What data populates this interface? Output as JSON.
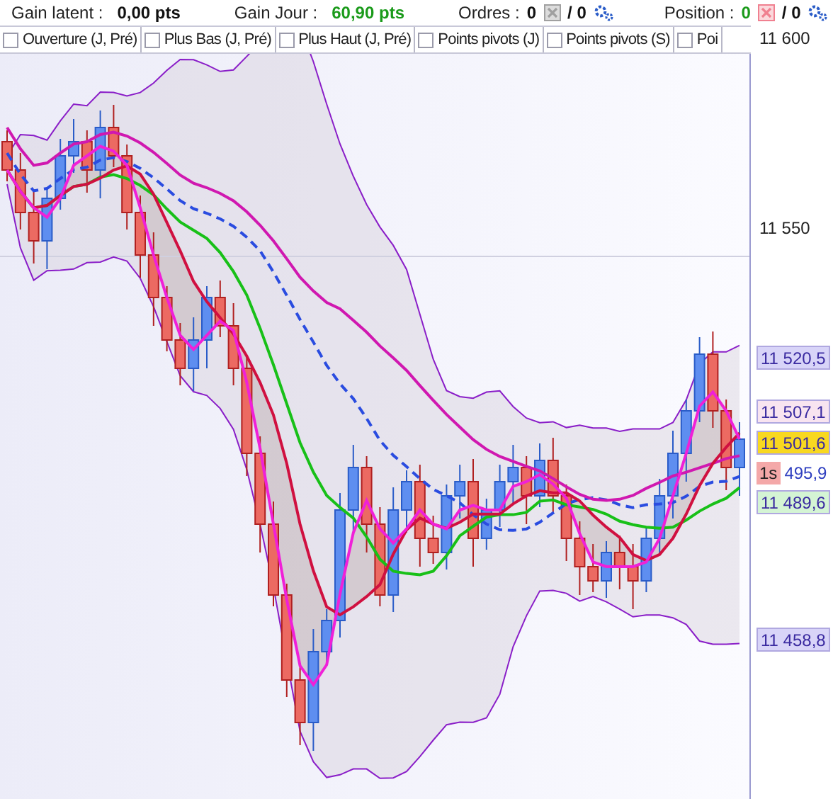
{
  "stats": [
    {
      "label": "Gain latent :",
      "value": "0,00 pts"
    },
    {
      "label": "Gain Jour :",
      "value": "60,90 pts",
      "color": "#1a9a1a"
    }
  ],
  "counters": [
    {
      "label": "Ordres :",
      "value": "0",
      "total": "/ 0",
      "kind": "orders"
    },
    {
      "label": "Position :",
      "value": "0",
      "color": "#1a9a1a",
      "total": "/ 0",
      "kind": "position"
    }
  ],
  "tabs": [
    {
      "label": "Ouverture (J, Pré)",
      "checked": false
    },
    {
      "label": "Plus Bas (J, Pré)",
      "checked": false
    },
    {
      "label": "Plus Haut (J, Pré)",
      "checked": false
    },
    {
      "label": "Points pivots (J)",
      "checked": false
    },
    {
      "label": "Points pivots (S)",
      "checked": false
    },
    {
      "label": "Poi",
      "checked": false
    }
  ],
  "axis": {
    "ticks": [
      "11 600",
      "11 550"
    ],
    "tags": [
      {
        "text": "11 520,5",
        "color": "#d8d4f8",
        "kind": "price"
      },
      {
        "text": "11 507,1",
        "color": "#f8e4f0",
        "kind": "price"
      },
      {
        "text": "11 501,6",
        "color": "#f8d820",
        "kind": "price"
      },
      {
        "text": "1s",
        "value": "495,9",
        "color": "#f4a8a8",
        "kind": "timer"
      },
      {
        "text": "11 489,6",
        "color": "#d4f4d4",
        "kind": "price"
      },
      {
        "text": "11 458,8",
        "color": "#d8d4f8",
        "kind": "price"
      }
    ]
  }
}
